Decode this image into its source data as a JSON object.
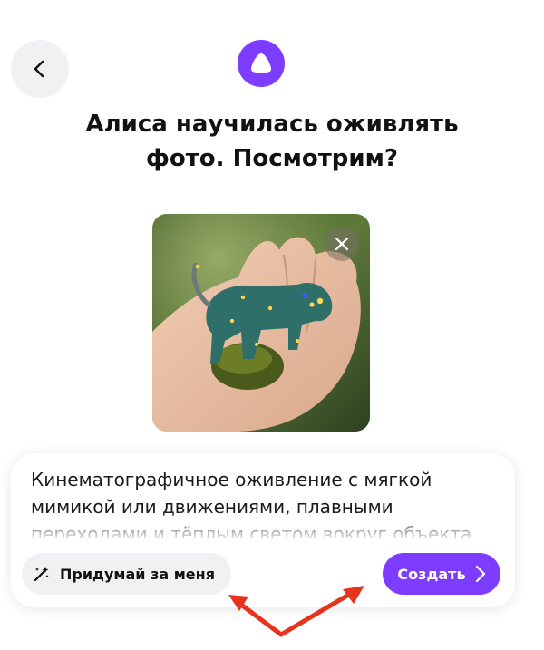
{
  "header": {
    "back_icon": "chevron-left-icon",
    "logo_icon": "alice-logo-icon",
    "logo_color": "#7d3cff"
  },
  "title": {
    "line1": "Алиса научилась оживлять",
    "line2": "фото. Посмотрим?"
  },
  "photo": {
    "remove_icon": "close-icon"
  },
  "prompt": {
    "text": "Кинематографичное оживление с мягкой мимикой или движениями, плавными переходами и тёплым светом вокруг объекта"
  },
  "actions": {
    "suggest_label": "Придумай за меня",
    "suggest_icon": "magic-wand-icon",
    "create_label": "Создать",
    "create_icon": "chevron-right-icon",
    "accent_color": "#7d3cff"
  },
  "annotation": {
    "arrow_color": "#e8331c"
  }
}
